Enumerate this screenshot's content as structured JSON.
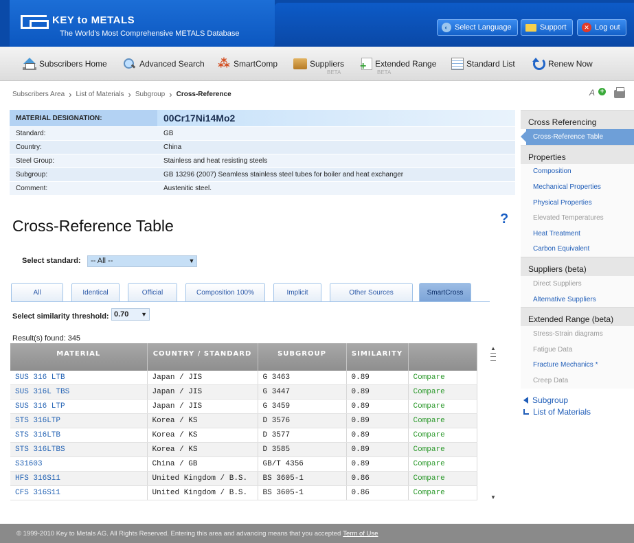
{
  "header": {
    "logo_title": "KEY to METALS",
    "logo_subtitle": "The World's Most Comprehensive METALS Database",
    "select_language": "Select Language",
    "support": "Support",
    "logout": "Log out"
  },
  "toolbar": {
    "subscribers_home": "Subscribers Home",
    "advanced_search": "Advanced Search",
    "smartcomp": "SmartComp",
    "suppliers": "Suppliers",
    "extended_range": "Extended Range",
    "beta": "BETA",
    "standard_list": "Standard List",
    "renew_now": "Renew Now"
  },
  "breadcrumb": {
    "items": [
      "Subscribers Area",
      "List of Materials",
      "Subgroup",
      "Cross-Reference"
    ]
  },
  "material": {
    "designation_label": "MATERIAL DESIGNATION:",
    "designation": "00Cr17Ni14Mo2",
    "rows": [
      {
        "label": "Standard:",
        "value": "GB"
      },
      {
        "label": "Country:",
        "value": "China"
      },
      {
        "label": "Steel Group:",
        "value": "Stainless and heat resisting steels"
      },
      {
        "label": "Subgroup:",
        "value": "GB 13296 (2007) Seamless stainless steel tubes for boiler and heat exchanger"
      },
      {
        "label": "Comment:",
        "value": "Austenitic steel."
      }
    ]
  },
  "section": {
    "title": "Cross-Reference Table",
    "help": "?"
  },
  "standard_select": {
    "label": "Select standard:",
    "value": "-- All --"
  },
  "tabs": [
    "All",
    "Identical",
    "Official",
    "Composition 100%",
    "Implicit",
    "Other Sources",
    "SmartCross"
  ],
  "threshold": {
    "label": "Select similarity threshold:",
    "value": "0.70"
  },
  "results": {
    "found": "Result(s) found: 345",
    "headers": [
      "MATERIAL",
      "COUNTRY / STANDARD",
      "SUBGROUP",
      "SIMILARITY",
      ""
    ],
    "rows": [
      [
        "SUS 316 LTB",
        "Japan / JIS",
        "G 3463",
        "0.89",
        "Compare"
      ],
      [
        "SUS 316L TBS",
        "Japan / JIS",
        "G 3447",
        "0.89",
        "Compare"
      ],
      [
        "SUS 316 LTP",
        "Japan / JIS",
        "G 3459",
        "0.89",
        "Compare"
      ],
      [
        "STS 316LTP",
        "Korea / KS",
        "D 3576",
        "0.89",
        "Compare"
      ],
      [
        "STS 316LTB",
        "Korea / KS",
        "D 3577",
        "0.89",
        "Compare"
      ],
      [
        "STS 316LTBS",
        "Korea / KS",
        "D 3585",
        "0.89",
        "Compare"
      ],
      [
        "S31603",
        "China / GB",
        "GB/T 4356",
        "0.89",
        "Compare"
      ],
      [
        "HFS 316S11",
        "United Kingdom / B.S.",
        "BS 3605-1",
        "0.86",
        "Compare"
      ],
      [
        "CFS 316S11",
        "United Kingdom / B.S.",
        "BS 3605-1",
        "0.86",
        "Compare"
      ]
    ]
  },
  "sidebar": {
    "sections": [
      {
        "title": "Cross Referencing",
        "items": [
          {
            "label": "Cross-Reference Table",
            "state": "active"
          }
        ]
      },
      {
        "title": "Properties",
        "items": [
          {
            "label": "Composition",
            "state": "link"
          },
          {
            "label": "Mechanical Properties",
            "state": "link"
          },
          {
            "label": "Physical Properties",
            "state": "link"
          },
          {
            "label": "Elevated Temperatures",
            "state": "dim"
          },
          {
            "label": "Heat Treatment",
            "state": "link"
          },
          {
            "label": "Carbon Equivalent",
            "state": "link"
          }
        ]
      },
      {
        "title": "Suppliers (beta)",
        "items": [
          {
            "label": "Direct Suppliers",
            "state": "dim"
          },
          {
            "label": "Alternative Suppliers",
            "state": "link"
          }
        ]
      },
      {
        "title": "Extended Range (beta)",
        "items": [
          {
            "label": "Stress-Strain diagrams",
            "state": "dim"
          },
          {
            "label": "Fatigue Data",
            "state": "dim"
          },
          {
            "label": "Fracture Mechanics *",
            "state": "link"
          },
          {
            "label": "Creep Data",
            "state": "dim"
          }
        ]
      }
    ],
    "back_links": {
      "subgroup": "Subgroup",
      "list_of_materials": "List of Materials"
    }
  },
  "footer": {
    "text": "© 1999-2010 Key to Metals AG. All Rights Reserved. Entering this area and advancing means that you accepted",
    "terms_link": "Term of Use"
  },
  "colors": {
    "header_blue": "#0a4aa8",
    "link_blue": "#2463b4",
    "compare_green": "#2e9a2e",
    "active_tab": "#7ca4d8",
    "sidebar_active": "#6e9fd8"
  }
}
